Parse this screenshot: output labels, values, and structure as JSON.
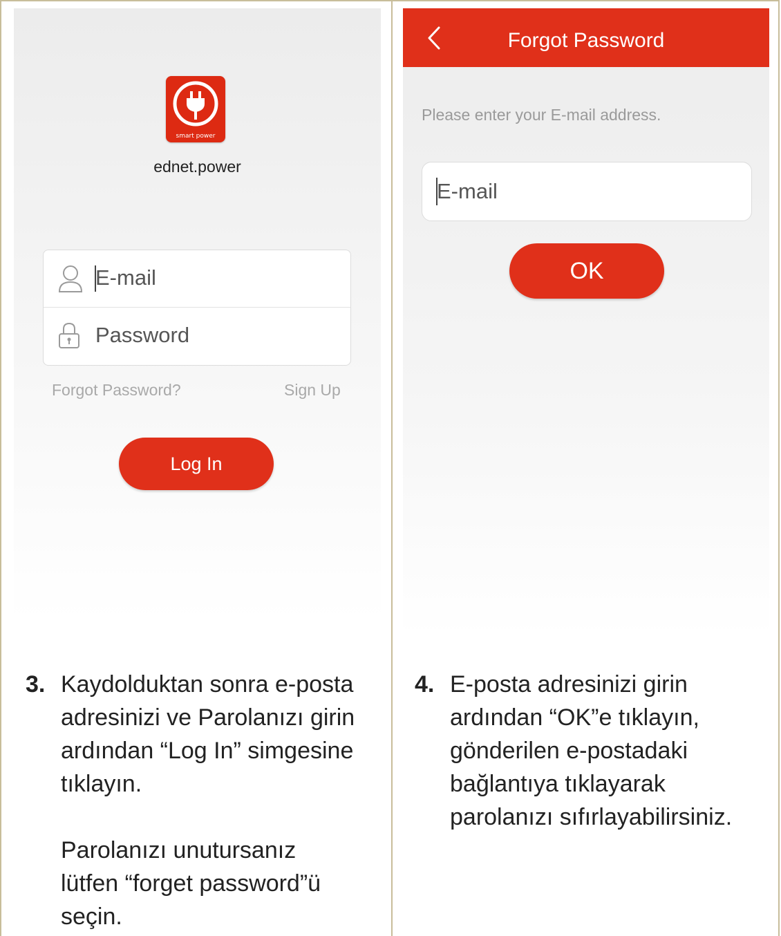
{
  "login_screen": {
    "logo_caption": "smart power",
    "app_name": "ednet.power",
    "email_placeholder": "E-mail",
    "password_placeholder": "Password",
    "forgot_link": "Forgot Password?",
    "signup_link": "Sign Up",
    "login_button": "Log In"
  },
  "forgot_screen": {
    "title": "Forgot Password",
    "hint": "Please enter your E-mail address.",
    "email_placeholder": "E-mail",
    "ok_button": "OK"
  },
  "instructions": {
    "step3": {
      "number": "3.",
      "lines": [
        "Kaydolduktan sonra e-posta",
        "adresinizi ve Parolanızı girin",
        "ardından “Log In” simgesine",
        "tıklayın."
      ],
      "note_lines": [
        "Parolanızı unutursanız",
        "lütfen “forget password”ü",
        "seçin."
      ]
    },
    "step4": {
      "number": "4.",
      "lines": [
        "E-posta adresinizi girin",
        "ardından “OK”e tıklayın,",
        "gönderilen e-postadaki",
        "bağlantıya tıklayarak",
        "parolanızı sıfırlayabilirsiniz."
      ]
    }
  },
  "colors": {
    "accent": "#e0301a",
    "border": "#c8bd9a"
  }
}
